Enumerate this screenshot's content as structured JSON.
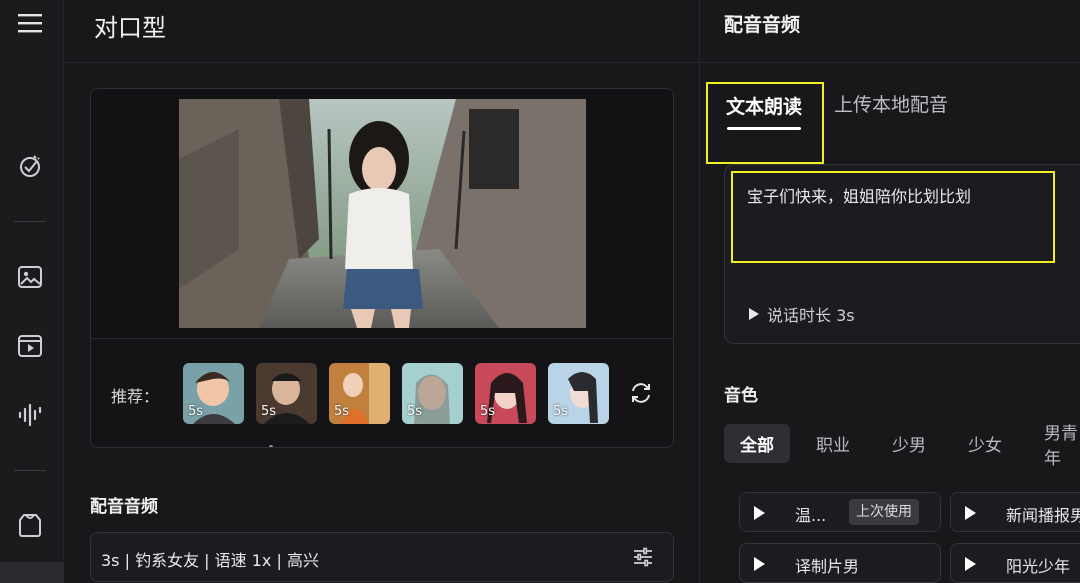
{
  "left": {
    "title": "对口型",
    "recommend_label": "推荐：",
    "thumbnails": [
      {
        "duration": "5s",
        "tone": "#7aa0a8"
      },
      {
        "duration": "5s",
        "tone": "#4a3a30"
      },
      {
        "duration": "5s",
        "tone": "#c2803e"
      },
      {
        "duration": "5s",
        "tone": "#a6d0cf"
      },
      {
        "duration": "5s",
        "tone": "#c84a5a"
      },
      {
        "duration": "5s",
        "tone": "#b9d4e6"
      }
    ],
    "audio_section_label": "配音音频",
    "audio_summary": "3s | 钓系女友 | 语速 1x | 高兴"
  },
  "right": {
    "title": "配音音频",
    "tabs": [
      {
        "label": "文本朗读",
        "active": true
      },
      {
        "label": "上传本地配音",
        "active": false
      }
    ],
    "text": "宝子们快来，姐姐陪你比划比划",
    "speak_duration": "说话时长 3s",
    "timbre_label": "音色",
    "categories": [
      "全部",
      "职业",
      "少男",
      "少女",
      "男青年"
    ],
    "voices": [
      {
        "name": "温...",
        "badge": "上次使用"
      },
      {
        "name": "新闻播报男"
      },
      {
        "name": "译制片男"
      },
      {
        "name": "阳光少年"
      }
    ]
  },
  "colors": {
    "highlight": "#f2ee1f",
    "background": "#18181b"
  }
}
